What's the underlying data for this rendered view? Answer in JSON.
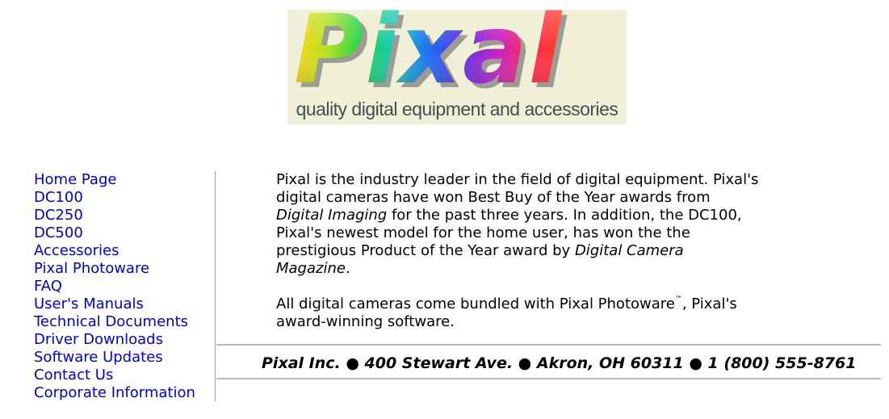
{
  "logo": {
    "wordmark": "Pixal",
    "tagline": "quality digital equipment and accessories"
  },
  "nav": {
    "items": [
      {
        "label": "Home Page"
      },
      {
        "label": "DC100"
      },
      {
        "label": "DC250"
      },
      {
        "label": "DC500"
      },
      {
        "label": "Accessories"
      },
      {
        "label": "Pixal Photoware"
      },
      {
        "label": "FAQ"
      },
      {
        "label": "User's Manuals"
      },
      {
        "label": "Technical Documents"
      },
      {
        "label": "Driver Downloads"
      },
      {
        "label": "Software Updates"
      },
      {
        "label": "Contact Us"
      },
      {
        "label": "Corporate Information"
      }
    ],
    "link_color": "#0000cc"
  },
  "main": {
    "p1_part1": "Pixal is the industry leader in the field of digital equipment. Pixal's digital cameras have won Best Buy of the Year awards from ",
    "p1_em1": "Digital Imaging",
    "p1_part2": " for the past three years. In addition, the DC100, Pixal's newest model for the home user, has won the the prestigious Product of the Year award by ",
    "p1_em2": "Digital Camera Magazine",
    "p1_part3": ".",
    "p2_part1": "All digital cameras come bundled with Pixal Photoware",
    "p2_tm": "™",
    "p2_part2": ", Pixal's award-winning software."
  },
  "footer": {
    "text": "Pixal Inc. ● 400 Stewart Ave. ● Akron, OH   60311 ● 1 (800) 555-8761"
  }
}
